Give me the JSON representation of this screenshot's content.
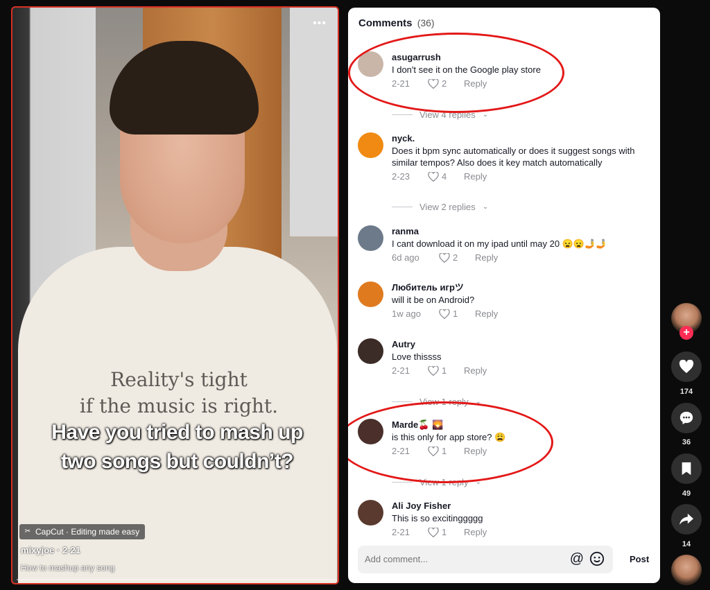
{
  "video": {
    "shirt_line1": "Reality's tight",
    "shirt_line2": "if the music is right.",
    "caption_line1": "Have you tried to mash up",
    "caption_line2": "two songs but couldn’t?",
    "capcut_label": "CapCut · Editing made easy",
    "author": "mixyjoe · 2-21",
    "description": "How to mashup any song",
    "more_icon": "more-dots-icon"
  },
  "comments_panel": {
    "title": "Comments",
    "count": "(36)",
    "items": [
      {
        "username": "asugarrush",
        "text": "I don't see it on the Google play store",
        "date": "2-21",
        "likes": "2",
        "reply": "Reply",
        "view_replies": "View 4 replies",
        "avatar_color": "#c9b6a8"
      },
      {
        "username": "nyck.",
        "text": "Does it bpm sync automatically or does it suggest songs with similar tempos? Also does it key match automatically",
        "date": "2-23",
        "likes": "4",
        "reply": "Reply",
        "view_replies": "View 2 replies",
        "avatar_color": "#f08a12"
      },
      {
        "username": "ranma",
        "text": "I cant download it on my ipad until may 20 😦😦🤳🤳",
        "date": "6d ago",
        "likes": "2",
        "reply": "Reply",
        "avatar_color": "#6c7a8a"
      },
      {
        "username": "Любитель игрツ",
        "text": "will it be on Android?",
        "date": "1w ago",
        "likes": "1",
        "reply": "Reply",
        "avatar_color": "#e07a1f"
      },
      {
        "username": "Autry",
        "text": "Love thissss",
        "date": "2-21",
        "likes": "1",
        "reply": "Reply",
        "view_replies": "View 1 reply",
        "avatar_color": "#3b2c28"
      },
      {
        "username": "Marde🍒 🌄",
        "text": "is this only for app store? 😩",
        "date": "2-21",
        "likes": "1",
        "reply": "Reply",
        "view_replies": "View 1 reply",
        "avatar_color": "#4a2f2a"
      },
      {
        "username": "Ali Joy Fisher",
        "text": "This is so excitinggggg",
        "date": "2-21",
        "likes": "1",
        "reply": "Reply",
        "avatar_color": "#5a3a2e"
      }
    ],
    "add_comment_placeholder": "Add comment...",
    "post_label": "Post",
    "accent_color": "#e31818"
  },
  "rail": {
    "likes": "174",
    "comments": "36",
    "saves": "49",
    "shares": "14",
    "follow_symbol": "+"
  }
}
